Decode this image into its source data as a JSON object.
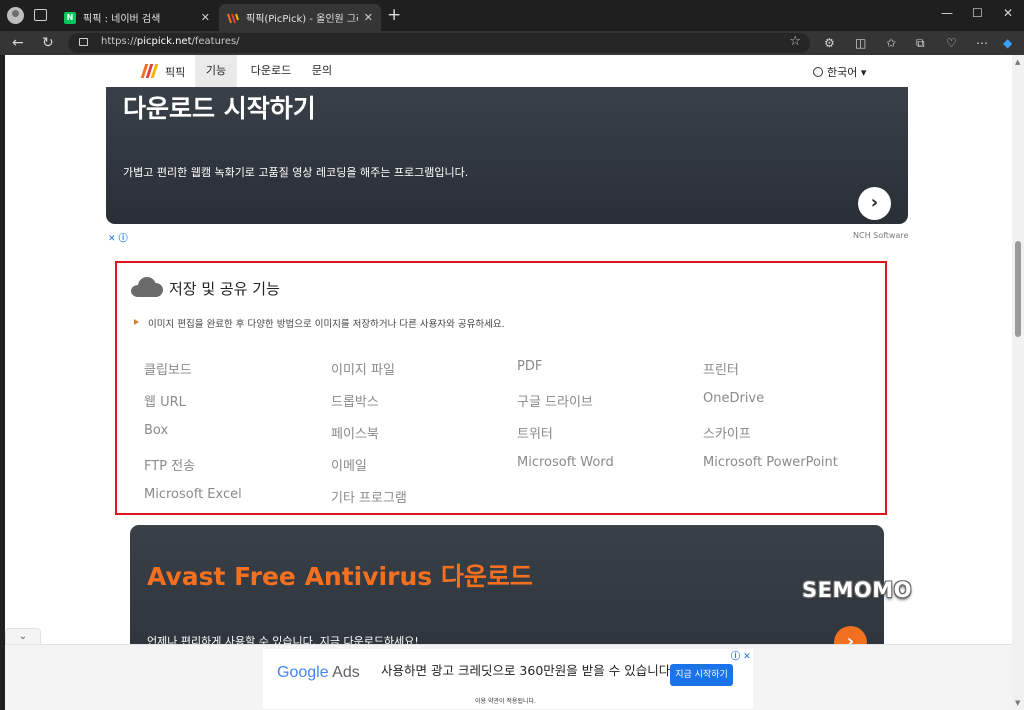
{
  "browser": {
    "tabs": [
      {
        "title": "픽픽 : 네이버 검색",
        "favicon": "naver-icon",
        "favicon_text": "N"
      },
      {
        "title": "픽픽(PicPick) - 올인원 그래픽 디자인",
        "favicon": "picpick-icon"
      }
    ],
    "url_prefix": "https://",
    "url_domain": "picpick.net",
    "url_path": "/features/"
  },
  "site_nav": {
    "brand": "픽픽",
    "items": [
      "기능",
      "다운로드",
      "문의"
    ],
    "active_item": "기능",
    "language": "한국어"
  },
  "ad_top": {
    "title": "다운로드 시작하기",
    "description": "가볍고 편리한 웹캠 녹화기로 고품질 영상 레코딩을 해주는 프로그램입니다.",
    "source": "NCH Software"
  },
  "feature": {
    "title": "저장 및 공유 기능",
    "description": "이미지 편집을 완료한 후 다양한 방법으로 이미지를 저장하거나 다른 사용자와 공유하세요.",
    "options": [
      "클립보드",
      "이미지 파일",
      "PDF",
      "프린터",
      "웹 URL",
      "드롭박스",
      "구글 드라이브",
      "OneDrive",
      "Box",
      "페이스북",
      "트위터",
      "스카이프",
      "FTP 전송",
      "이메일",
      "Microsoft Word",
      "Microsoft PowerPoint",
      "Microsoft Excel",
      "기타 프로그램"
    ]
  },
  "ad_bottom_card": {
    "title": "Avast Free Antivirus 다운로드",
    "description": "언제나 편리하게 사용할 수 있습니다. 지금 다운로드하세요!"
  },
  "watermark": "SEMOMO",
  "google_ad": {
    "logo_google": "Google",
    "logo_ads": "Ads",
    "message": "사용하면 광고 크레딧으로 360만원을 받을 수 있습니다.",
    "button": "지금 시작하기",
    "terms": "이용 약관이 적용됩니다."
  },
  "colors": {
    "highlight_border": "#e0141f",
    "avast_orange": "#f37021",
    "naver_green": "#03c75a"
  }
}
